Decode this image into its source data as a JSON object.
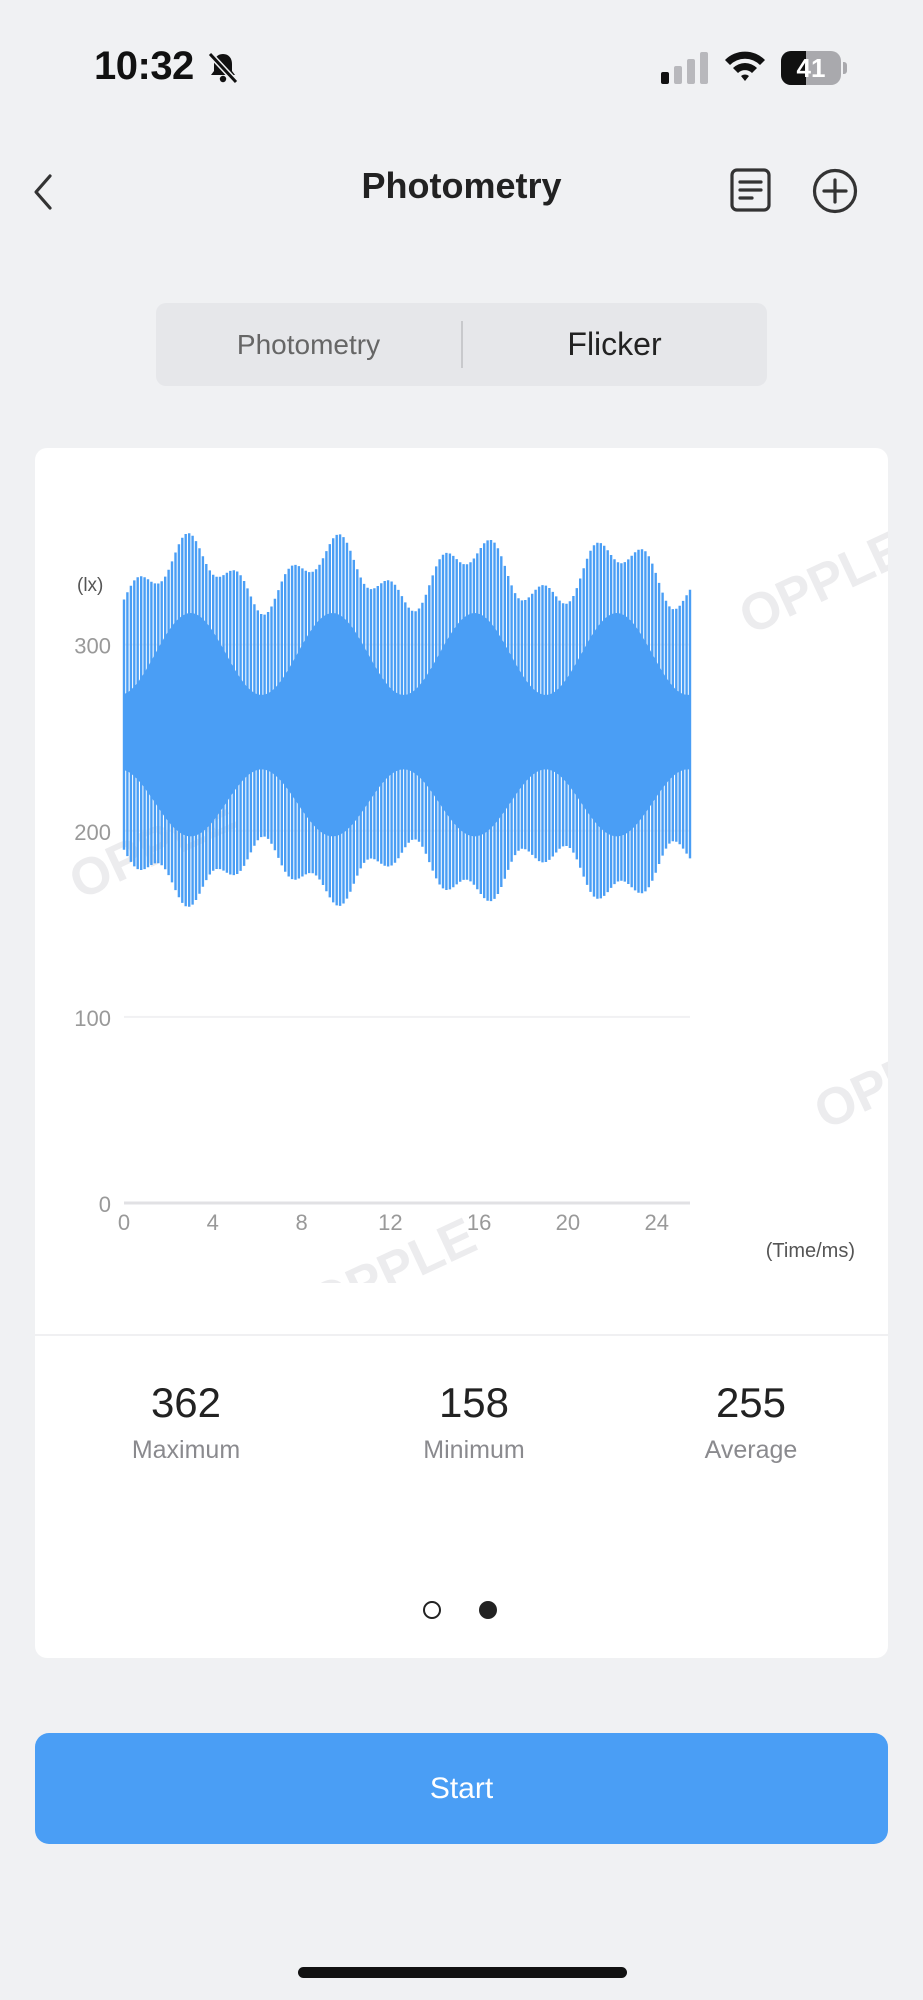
{
  "status_bar": {
    "time": "10:32",
    "battery_level": 41,
    "icons": [
      "bell-slash-icon",
      "signal-icon",
      "wifi-icon",
      "battery-icon"
    ]
  },
  "nav": {
    "title": "Photometry",
    "icons": [
      "back-icon",
      "document-icon",
      "add-circle-icon"
    ]
  },
  "tabs": [
    {
      "label": "Photometry",
      "selected": false
    },
    {
      "label": "Flicker",
      "selected": true
    }
  ],
  "watermark": "OPPLE",
  "chart_data": {
    "type": "line",
    "ylabel": "(lx)",
    "xlabel": "(Time/ms)",
    "y_ticks": [
      "0",
      "100",
      "200",
      "300"
    ],
    "x_ticks": [
      "0",
      "4",
      "8",
      "12",
      "16",
      "20",
      "24"
    ],
    "ylim": [
      0,
      360
    ],
    "xlim": [
      0,
      25.5
    ],
    "grid": "horizontal",
    "color": "#4a9ef5",
    "waveform": {
      "mean": 255,
      "max": 362,
      "min": 158,
      "inner_band": [
        205,
        320
      ],
      "modulation_period_ms": 6.4
    }
  },
  "stats": {
    "maximum": {
      "value": "362",
      "label": "Maximum"
    },
    "minimum": {
      "value": "158",
      "label": "Minimum"
    },
    "average": {
      "value": "255",
      "label": "Average"
    }
  },
  "pager": {
    "pages": 2,
    "active": 2
  },
  "start_button": {
    "label": "Start"
  },
  "colors": {
    "accent": "#4a9ef5",
    "background": "#f0f1f3"
  }
}
